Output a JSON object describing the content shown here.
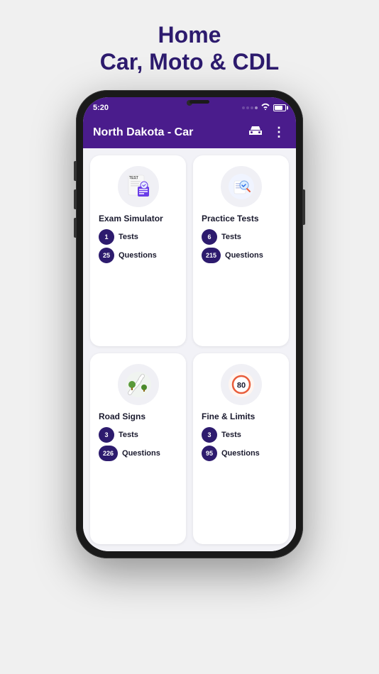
{
  "page": {
    "title_line1": "Home",
    "title_line2": "Car, Moto & CDL"
  },
  "status_bar": {
    "time": "5:20"
  },
  "nav": {
    "title": "North Dakota - Car"
  },
  "cards": [
    {
      "id": "exam-simulator",
      "label": "Exam Simulator",
      "stats": [
        {
          "value": "1",
          "wide": false,
          "label": "Tests"
        },
        {
          "value": "25",
          "wide": false,
          "label": "Questions"
        }
      ]
    },
    {
      "id": "practice-tests",
      "label": "Practice Tests",
      "stats": [
        {
          "value": "6",
          "wide": false,
          "label": "Tests"
        },
        {
          "value": "215",
          "wide": true,
          "label": "Questions"
        }
      ]
    },
    {
      "id": "road-signs",
      "label": "Road Signs",
      "stats": [
        {
          "value": "3",
          "wide": false,
          "label": "Tests"
        },
        {
          "value": "226",
          "wide": true,
          "label": "Questions"
        }
      ]
    },
    {
      "id": "fine-limits",
      "label": "Fine & Limits",
      "stats": [
        {
          "value": "3",
          "wide": false,
          "label": "Tests"
        },
        {
          "value": "95",
          "wide": false,
          "label": "Questions"
        }
      ]
    }
  ]
}
